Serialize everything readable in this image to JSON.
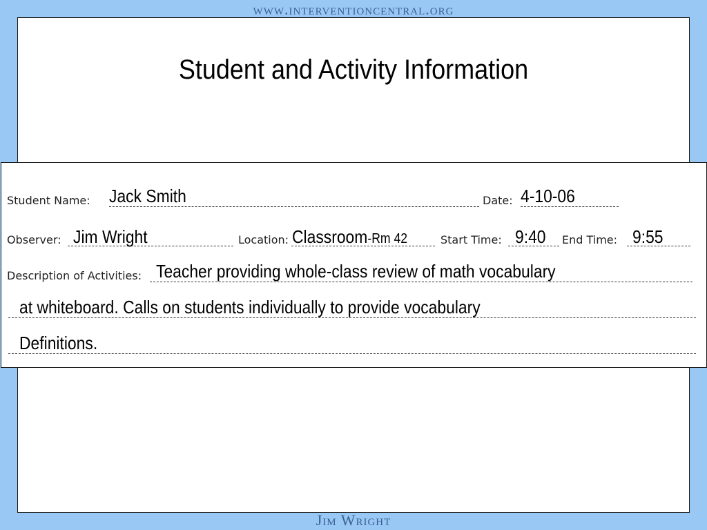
{
  "header": {
    "site_url": "www.interventioncentral.org"
  },
  "footer": {
    "author": "Jim Wright"
  },
  "slide": {
    "title": "Student and Activity Information"
  },
  "form": {
    "student_name_label": "Student Name:",
    "student_name_value": "Jack Smith",
    "date_label": "Date:",
    "date_value": "4-10-06",
    "observer_label": "Observer:",
    "observer_value": "Jim Wright",
    "location_label": "Location:",
    "location_value": "Classroom",
    "location_room": "-Rm 42",
    "start_time_label": "Start Time:",
    "start_time_value": "9:40",
    "end_time_label": "End Time:",
    "end_time_value": "9:55",
    "description_label": "Description of Activities:",
    "description_lines": [
      "Teacher providing whole-class review of math vocabulary",
      "at whiteboard. Calls on students individually to provide vocabulary",
      "Definitions."
    ]
  }
}
